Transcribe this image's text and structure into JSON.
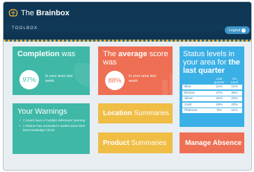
{
  "app": {
    "brand_prefix": "The ",
    "brand_name": "Brainbox",
    "section": "TOOLBOX",
    "logout_label": "Logout"
  },
  "completion": {
    "title_bold": "Completion",
    "title_rest": " was",
    "value": "97%",
    "note": "in your area last week"
  },
  "average": {
    "title_pre": "The ",
    "title_bold": "average",
    "title_rest": " score was",
    "value": "88%",
    "note": "in your area last week"
  },
  "status": {
    "title_pre": "Status levels in your area for ",
    "title_bold": "the last quarter",
    "col_last": "Last quarter",
    "col_track": "On track",
    "rows": [
      {
        "level": "Blue",
        "last": "12%",
        "track": "12%"
      },
      {
        "level": "Bronze",
        "last": "37%",
        "track": "35%"
      },
      {
        "level": "Silver",
        "last": "24%",
        "track": "22%"
      },
      {
        "level": "Gold",
        "last": "18%",
        "track": "20%"
      },
      {
        "level": "Platinum",
        "last": "9%",
        "track": "11%"
      }
    ]
  },
  "warnings": {
    "title": "Your Warnings",
    "items": [
      "2 Users have a 'multiple deferment' warning",
      "1 Partner has exceeded 4 weeks since their last Knowledge Check"
    ]
  },
  "location": {
    "bold": "Location",
    "rest": " Summaries"
  },
  "product": {
    "bold": "Product",
    "rest": " Summaries"
  },
  "manage": {
    "label": "Manage Absence"
  },
  "colors": {
    "header": "#103a58",
    "teal": "#3fb8a7",
    "coral": "#ee6f53",
    "sky": "#3bb0e6",
    "amber": "#f0bd45"
  }
}
